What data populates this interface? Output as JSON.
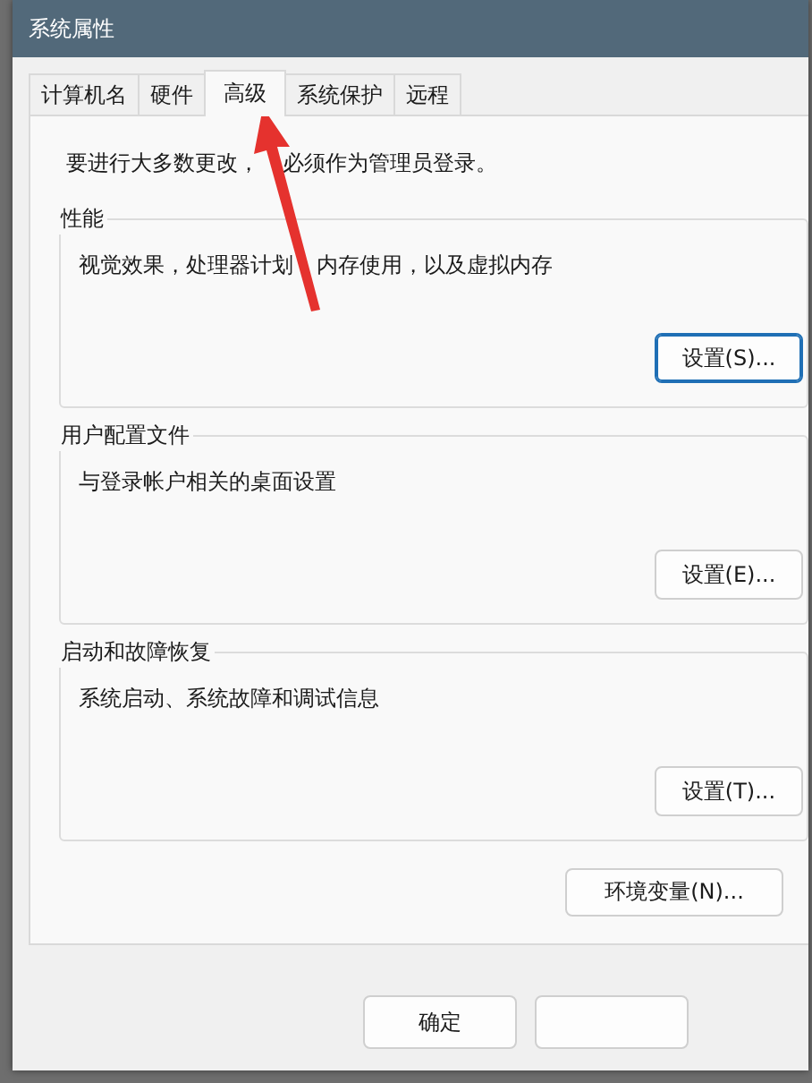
{
  "window": {
    "title": "系统属性"
  },
  "tabs": [
    {
      "label": "计算机名",
      "selected": false
    },
    {
      "label": "硬件",
      "selected": false
    },
    {
      "label": "高级",
      "selected": true
    },
    {
      "label": "系统保护",
      "selected": false
    },
    {
      "label": "远程",
      "selected": false
    }
  ],
  "notice": [
    "要进行大多数更改，",
    "必须作为管理员登录。"
  ],
  "groups": [
    {
      "title": "性能",
      "description": [
        "视觉效果，处理器计划",
        "内存使用，以及虚拟内存"
      ],
      "button": "设置(S)...",
      "focused": true
    },
    {
      "title": "用户配置文件",
      "description": [
        "与登录帐户相关的桌面设置"
      ],
      "button": "设置(E)...",
      "focused": false
    },
    {
      "title": "启动和故障恢复",
      "description": [
        "系统启动、系统故障和调试信息"
      ],
      "button": "设置(T)...",
      "focused": false
    }
  ],
  "env_button": "环境变量(N)...",
  "buttons": [
    {
      "kind": "labeled",
      "label": "确定"
    },
    {
      "kind": "blank"
    }
  ]
}
